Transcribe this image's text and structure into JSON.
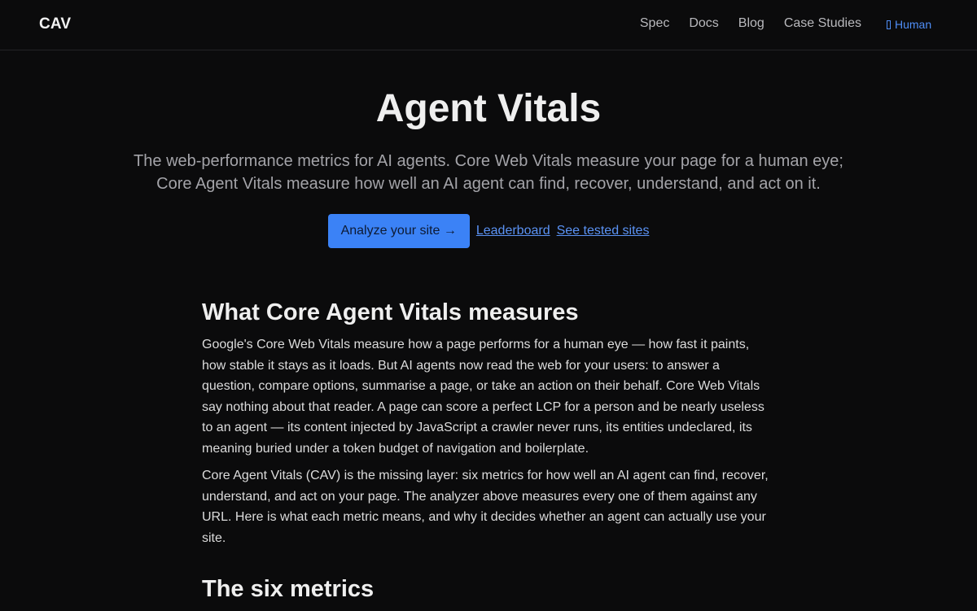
{
  "header": {
    "brand": "CAV",
    "nav": [
      "Spec",
      "Docs",
      "Blog",
      "Case Studies"
    ],
    "mode_toggle": "Human"
  },
  "hero": {
    "title": "Agent Vitals",
    "subtitle": "The web-performance metrics for AI agents. Core Web Vitals measure your page for a human eye; Core Agent Vitals measure how well an AI agent can find, recover, understand, and act on it.",
    "cta_primary": "Analyze your site →",
    "cta_links": [
      "Leaderboard",
      "See tested sites"
    ]
  },
  "content": {
    "section1_heading": "What Core Agent Vitals measures",
    "paragraphs": [
      "Google's Core Web Vitals measure how a page performs for a human eye — how fast it paints, how stable it stays as it loads. But AI agents now read the web for your users: to answer a question, compare options, summarise a page, or take an action on their behalf. Core Web Vitals say nothing about that reader. A page can score a perfect LCP for a person and be nearly useless to an agent — its content injected by JavaScript a crawler never runs, its entities undeclared, its meaning buried under a token budget of navigation and boilerplate.",
      "Core Agent Vitals (CAV) is the missing layer: six metrics for how well an AI agent can find, recover, understand, and act on your page. The analyzer above measures every one of them against any URL. Here is what each metric means, and why it decides whether an agent can actually use your site."
    ],
    "section2_heading": "The six metrics"
  },
  "colors": {
    "background": "#0b0b0c",
    "accent": "#3b82f6",
    "link": "#5b93f5"
  }
}
